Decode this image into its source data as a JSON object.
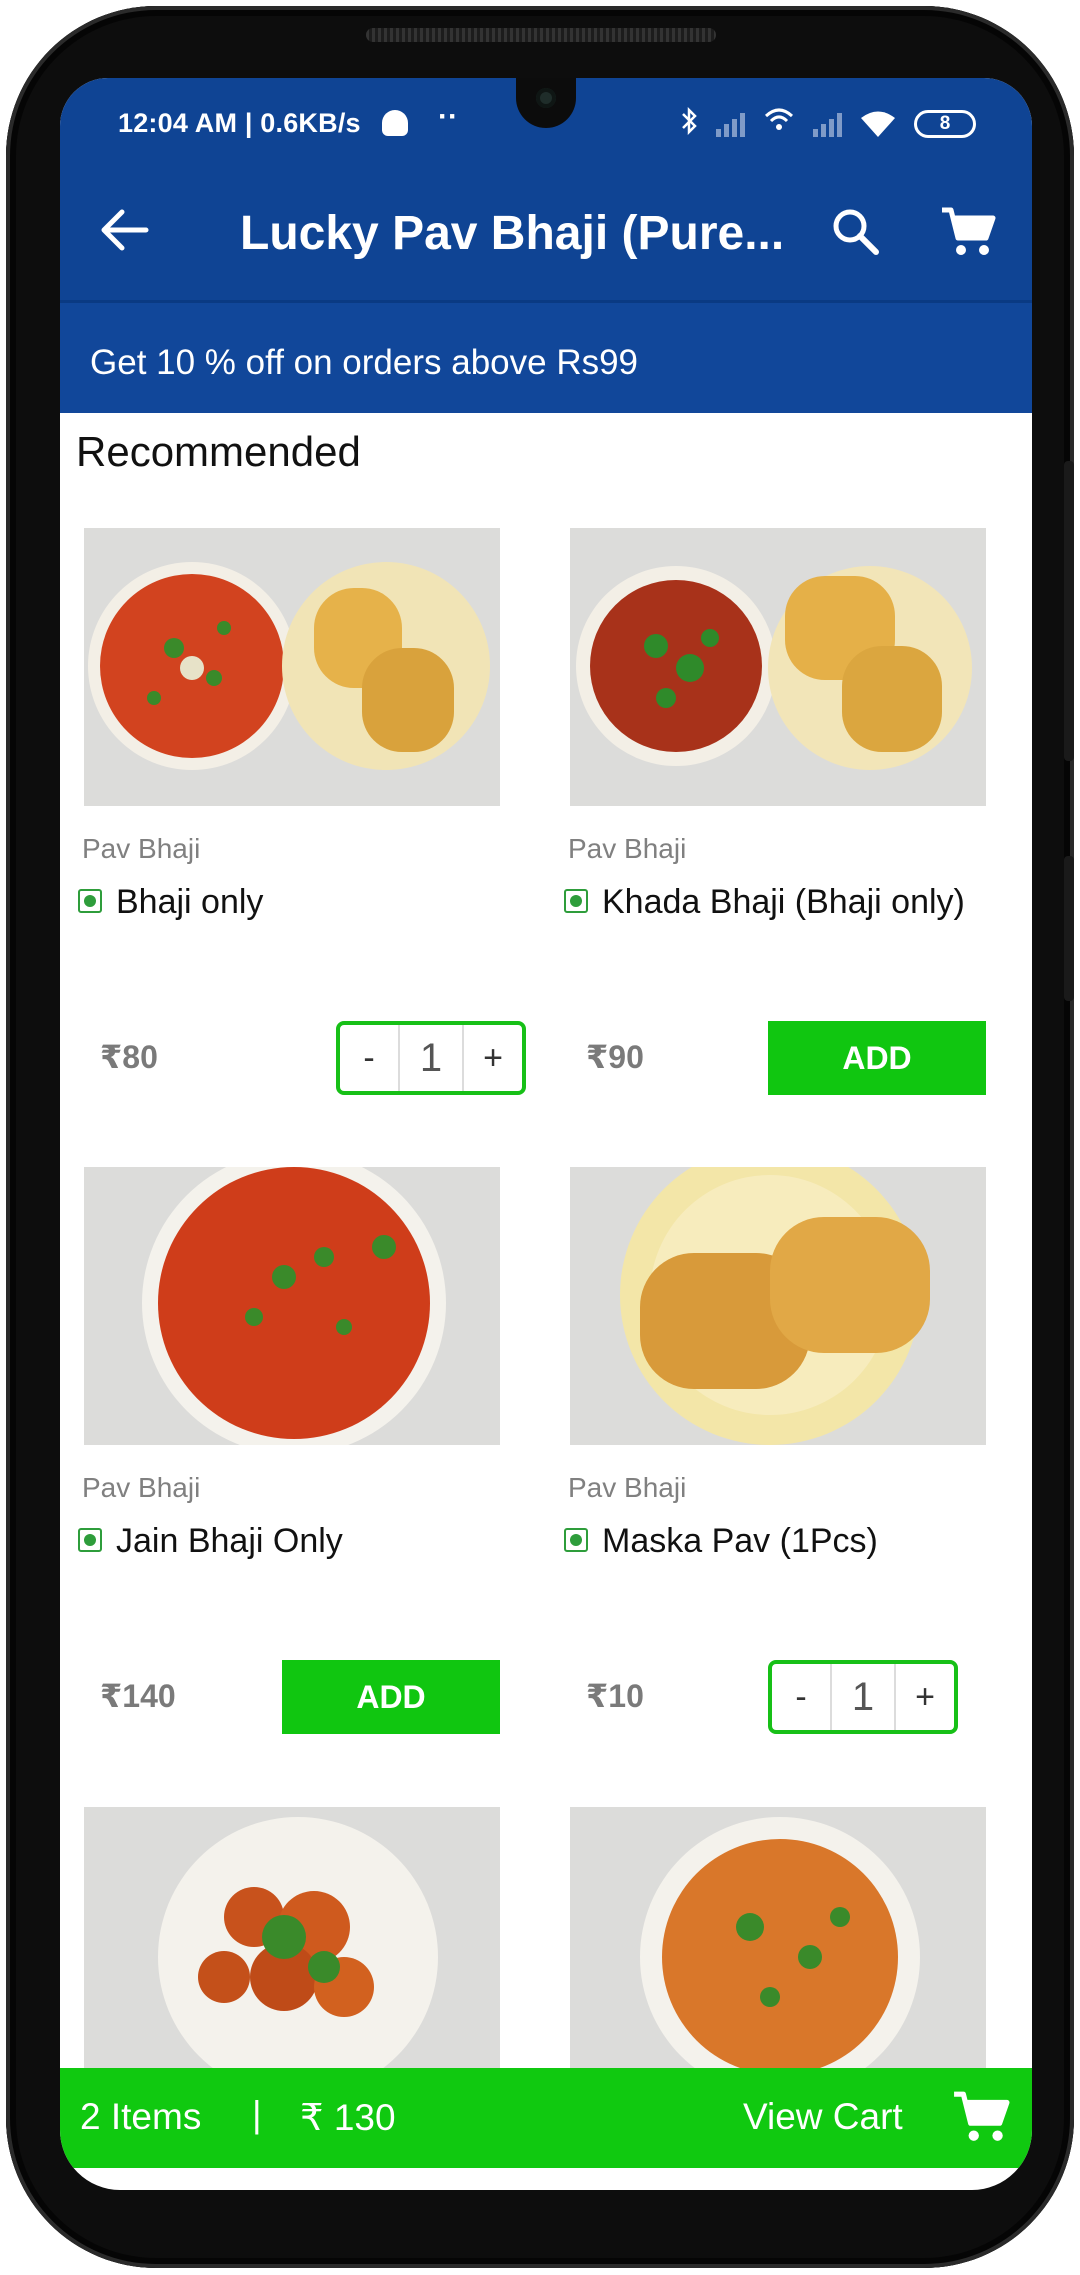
{
  "status_bar": {
    "time": "12:04 AM | 0.6KB/s",
    "dots": "··",
    "battery": "8"
  },
  "header": {
    "title": "Lucky Pav Bhaji (Pure...",
    "back_icon": "arrow-left-icon",
    "search_icon": "search-icon",
    "cart_icon": "cart-icon"
  },
  "offer": {
    "text": "Get 10 % off on orders above Rs99"
  },
  "section": {
    "title": "Recommended"
  },
  "products": [
    {
      "category": "Pav Bhaji",
      "name": "Bhaji only",
      "price": "₹80",
      "in_cart": true,
      "qty": "1"
    },
    {
      "category": "Pav Bhaji",
      "name": "Khada Bhaji (Bhaji only)",
      "price": "₹90",
      "in_cart": false,
      "add_label": "ADD"
    },
    {
      "category": "Pav Bhaji",
      "name": "Jain Bhaji Only",
      "price": "₹140",
      "in_cart": false,
      "add_label": "ADD"
    },
    {
      "category": "Pav Bhaji",
      "name": "Maska Pav (1Pcs)",
      "price": "₹10",
      "in_cart": true,
      "qty": "1"
    }
  ],
  "stepper": {
    "minus": "-",
    "plus": "+"
  },
  "cart_bar": {
    "items": "2 Items",
    "separator": "|",
    "total": "₹ 130",
    "view_cart": "View Cart"
  },
  "colors": {
    "primary": "#0f4494",
    "accent_green": "#10c610",
    "veg_green": "#2e9d3b"
  }
}
